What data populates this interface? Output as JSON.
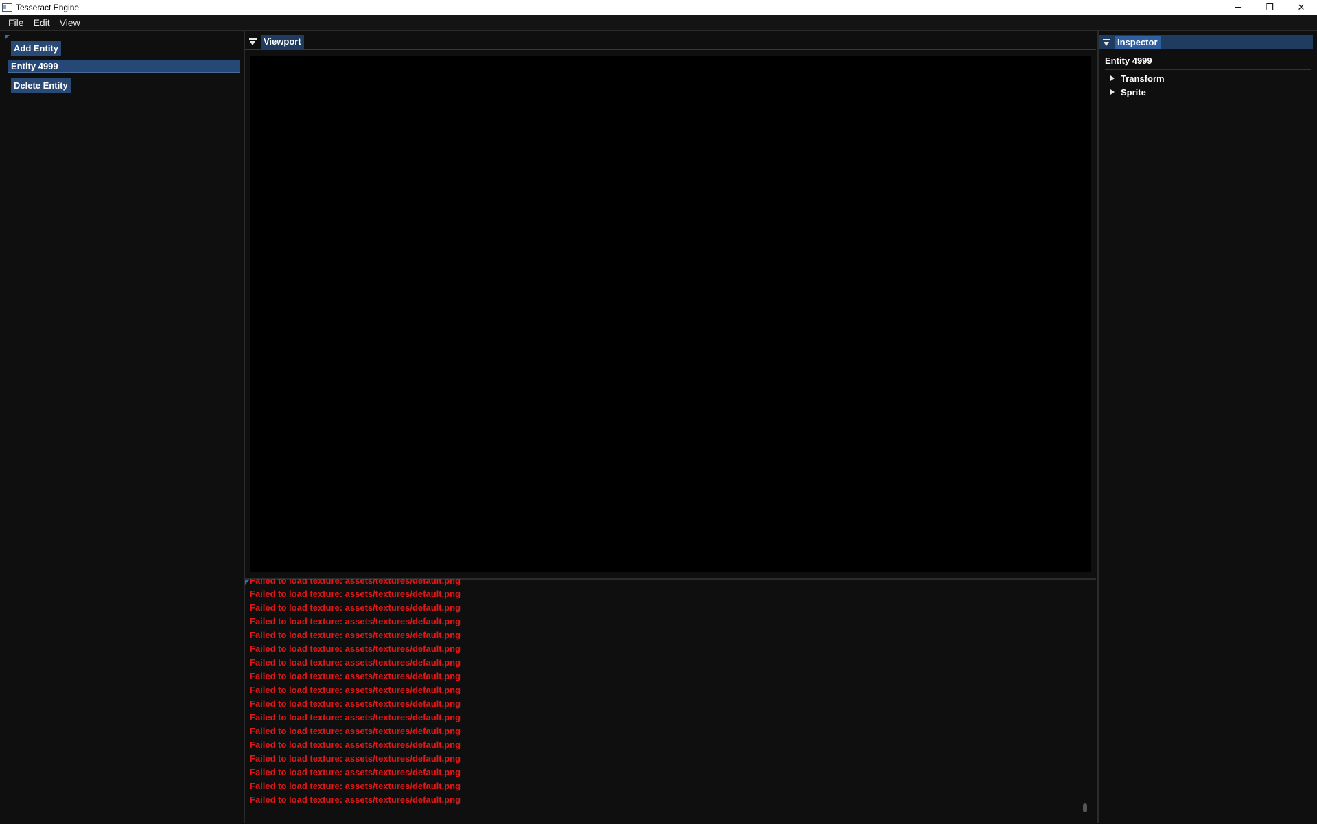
{
  "window": {
    "title": "Tesseract Engine",
    "controls": {
      "minimize": "─",
      "maximize": "❐",
      "close": "✕"
    }
  },
  "menubar": {
    "items": [
      "File",
      "Edit",
      "View"
    ]
  },
  "scene_panel": {
    "add_button": "Add Entity",
    "selected_entity": "Entity 4999",
    "delete_button": "Delete Entity"
  },
  "viewport": {
    "tab_label": "Viewport"
  },
  "console": {
    "line_color": "#e01818",
    "lines": [
      "Failed to load texture: assets/textures/default.png",
      "Failed to load texture: assets/textures/default.png",
      "Failed to load texture: assets/textures/default.png",
      "Failed to load texture: assets/textures/default.png",
      "Failed to load texture: assets/textures/default.png",
      "Failed to load texture: assets/textures/default.png",
      "Failed to load texture: assets/textures/default.png",
      "Failed to load texture: assets/textures/default.png",
      "Failed to load texture: assets/textures/default.png",
      "Failed to load texture: assets/textures/default.png",
      "Failed to load texture: assets/textures/default.png",
      "Failed to load texture: assets/textures/default.png",
      "Failed to load texture: assets/textures/default.png",
      "Failed to load texture: assets/textures/default.png",
      "Failed to load texture: assets/textures/default.png",
      "Failed to load texture: assets/textures/default.png",
      "Failed to load texture: assets/textures/default.png"
    ]
  },
  "inspector": {
    "tab_label": "Inspector",
    "entity_name": "Entity 4999",
    "components": [
      "Transform",
      "Sprite"
    ]
  },
  "colors": {
    "accent": "#2e5fa0",
    "button": "#2a4a76",
    "selection": "#254877",
    "error_text": "#e01818",
    "background": "#0f0f0f"
  }
}
